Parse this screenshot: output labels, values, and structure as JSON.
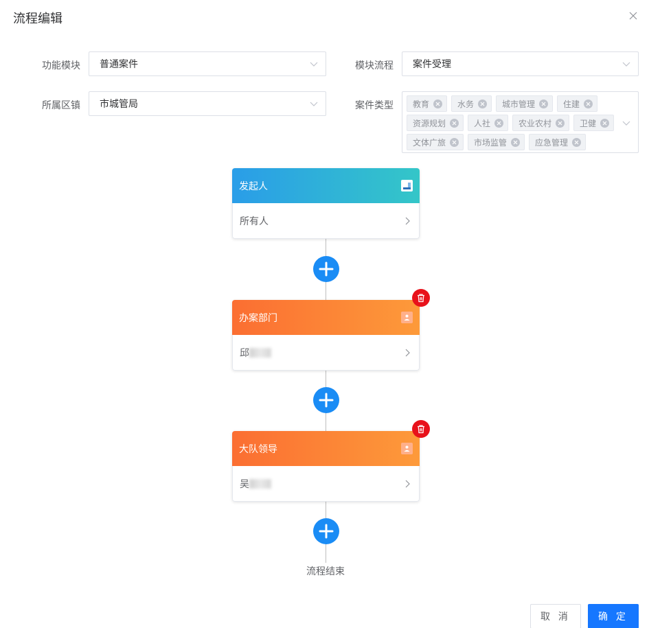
{
  "dialog": {
    "title": "流程编辑"
  },
  "form": {
    "function_module": {
      "label": "功能模块",
      "value": "普通案件"
    },
    "module_flow": {
      "label": "模块流程",
      "value": "案件受理"
    },
    "district": {
      "label": "所属区镇",
      "value": "市城管局"
    },
    "case_type": {
      "label": "案件类型",
      "tags": [
        [
          "教育",
          "水务",
          "城市管理",
          "住建"
        ],
        [
          "资源规划",
          "人社",
          "农业农村",
          "卫健"
        ],
        [
          "文体广旅",
          "市场监管",
          "应急管理"
        ]
      ]
    }
  },
  "flow": {
    "nodes": [
      {
        "title": "发起人",
        "assignee": "所有人",
        "color": "#2a9de8"
      },
      {
        "title": "办案部门",
        "assignee": "邱",
        "color": "#fb6e32"
      },
      {
        "title": "大队领导",
        "assignee": "吴",
        "color": "#fb6e32"
      }
    ],
    "end_label": "流程结束",
    "add_color": "#1a8cf5",
    "delete_color": "#e8121b"
  },
  "footer": {
    "cancel_label": "取 消",
    "confirm_label": "确 定",
    "confirm_color": "#1677ff"
  }
}
